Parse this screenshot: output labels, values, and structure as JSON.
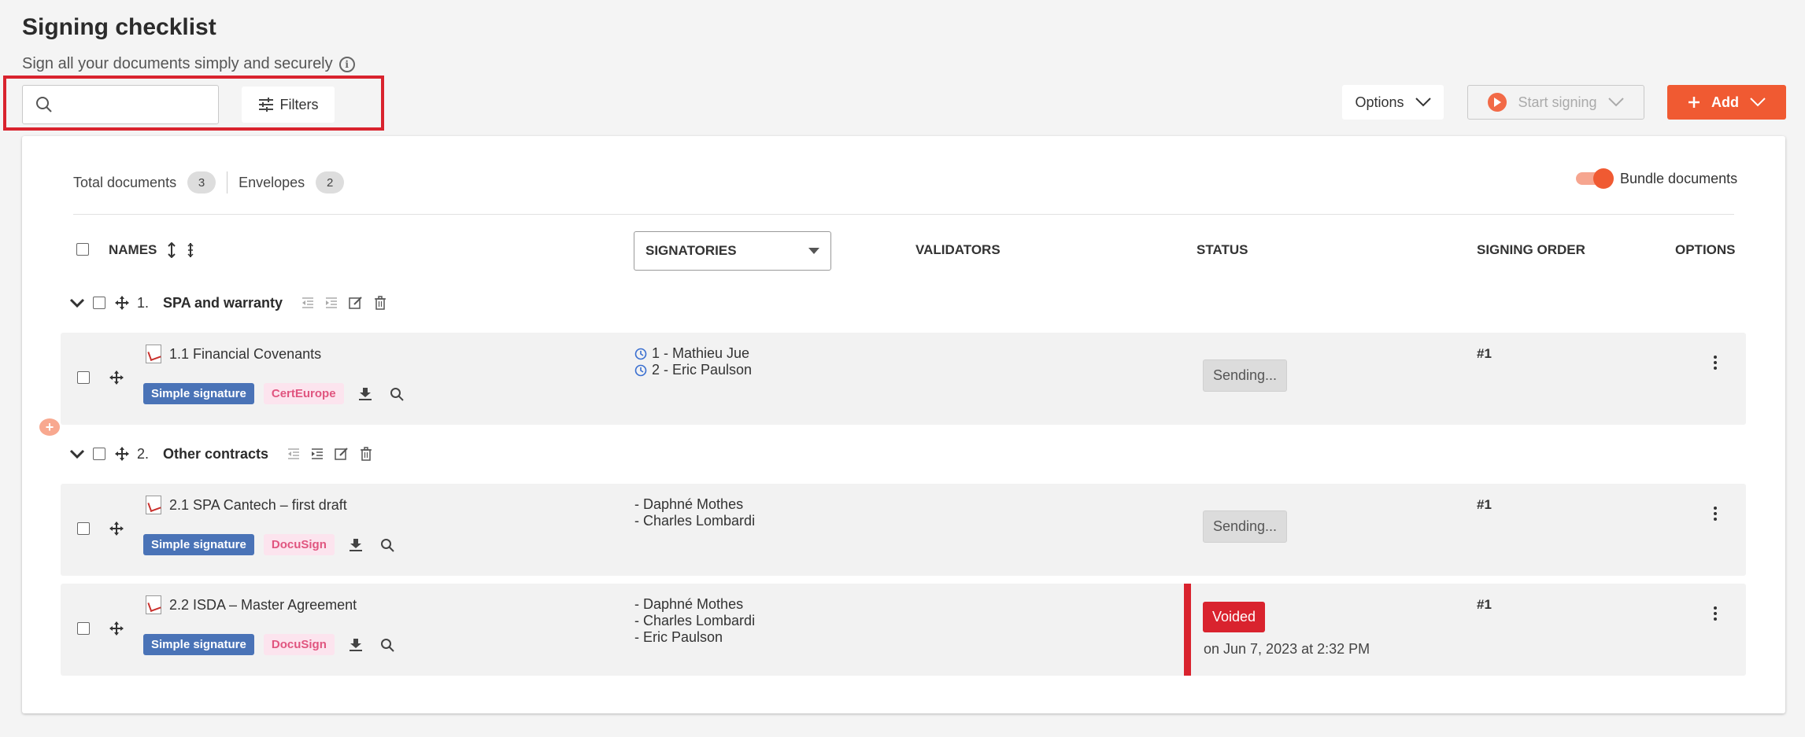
{
  "header": {
    "title": "Signing checklist",
    "subtitle": "Sign all your documents simply and securely"
  },
  "toolbar": {
    "search_value": "",
    "search_placeholder": "",
    "filters_label": "Filters",
    "options_label": "Options",
    "start_signing_label": "Start signing",
    "add_label": "Add"
  },
  "summary": {
    "total_documents_label": "Total documents",
    "total_documents_count": "3",
    "envelopes_label": "Envelopes",
    "envelopes_count": "2",
    "bundle_label": "Bundle documents",
    "bundle_on": true
  },
  "table": {
    "col_names": "NAMES",
    "col_signatories": "SIGNATORIES",
    "col_validators": "VALIDATORS",
    "col_status": "STATUS",
    "col_signing_order": "SIGNING ORDER",
    "col_options": "OPTIONS"
  },
  "groups": [
    {
      "number": "1.",
      "title": "SPA and warranty",
      "documents": [
        {
          "title": "1.1 Financial Covenants",
          "signature_type": "Simple signature",
          "provider": "CertEurope",
          "signatories": [
            "1 - Mathieu Jue",
            "2 - Eric Paulson"
          ],
          "status": "Sending...",
          "order": "#1"
        }
      ]
    },
    {
      "number": "2.",
      "title": "Other contracts",
      "documents": [
        {
          "title": "2.1 SPA Cantech – first draft",
          "signature_type": "Simple signature",
          "provider": "DocuSign",
          "signatories": [
            "- Daphné Mothes",
            "- Charles Lombardi"
          ],
          "status": "Sending...",
          "order": "#1"
        },
        {
          "title": "2.2 ISDA – Master Agreement",
          "signature_type": "Simple signature",
          "provider": "DocuSign",
          "signatories": [
            "- Daphné Mothes",
            "- Charles Lombardi",
            "- Eric Paulson"
          ],
          "status": "Voided",
          "status_date": "on Jun 7, 2023 at 2:32 PM",
          "order": "#1"
        }
      ]
    }
  ],
  "colors": {
    "accent": "#f05a32",
    "void": "#d9232e",
    "simple_signature_tag": "#4a73b7",
    "provider_tag_text": "#e0557f",
    "highlight": "#d9232e"
  }
}
